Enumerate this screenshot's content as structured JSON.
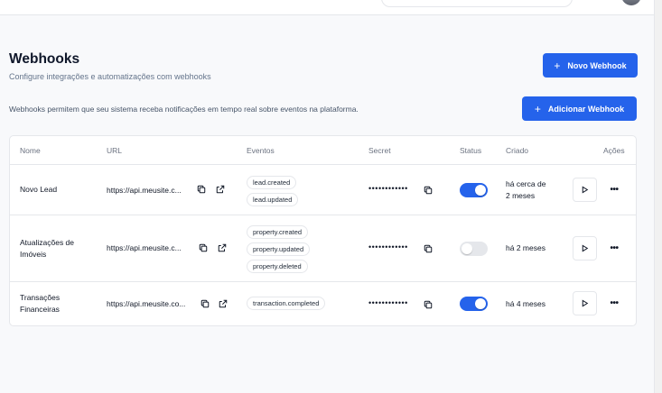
{
  "header": {
    "title": "Webhooks",
    "subtitle": "Configure integrações e automatizações com webhooks",
    "new_button_label": "Novo Webhook"
  },
  "info": {
    "text": "Webhooks permitem que seu sistema receba notificações em tempo real sobre eventos na plataforma.",
    "add_button_label": "Adicionar Webhook"
  },
  "table": {
    "columns": {
      "name": "Nome",
      "url": "URL",
      "events": "Eventos",
      "secret": "Secret",
      "status": "Status",
      "created": "Criado",
      "actions": "Ações"
    },
    "rows": [
      {
        "name_line1": "Novo Lead",
        "name_line2": "",
        "url": "https://api.meusite.c...",
        "events": [
          "lead.created",
          "lead.updated"
        ],
        "secret": "••••••••••••",
        "status_on": true,
        "created_line1": "há cerca de",
        "created_line2": "2 meses"
      },
      {
        "name_line1": "Atualizações de",
        "name_line2": "Imóveis",
        "url": "https://api.meusite.c...",
        "events": [
          "property.created",
          "property.updated",
          "property.deleted"
        ],
        "secret": "••••••••••••",
        "status_on": false,
        "created_line1": "há 2 meses",
        "created_line2": ""
      },
      {
        "name_line1": "Transações",
        "name_line2": "Financeiras",
        "url": "https://api.meusite.co...",
        "events": [
          "transaction.completed"
        ],
        "secret": "••••••••••••",
        "status_on": true,
        "created_line1": "há 4 meses",
        "created_line2": ""
      }
    ]
  },
  "colors": {
    "accent": "#2563eb",
    "toggle_off": "#e5e7eb",
    "border": "#e5e7eb",
    "background": "#f8f9fb"
  },
  "icons": {
    "copy": "copy-icon",
    "external": "external-link-icon",
    "play": "play-icon",
    "more": "more-horizontal-icon",
    "plus": "plus-icon"
  }
}
